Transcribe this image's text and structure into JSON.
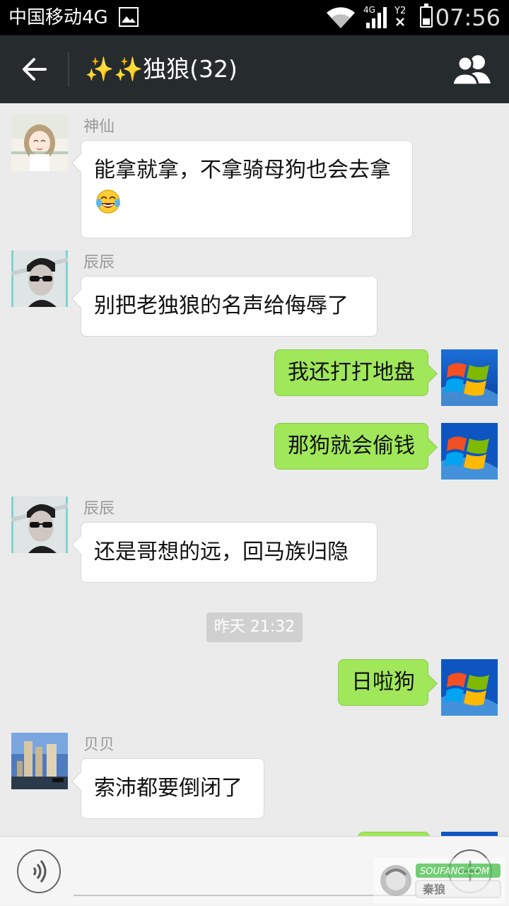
{
  "status_bar": {
    "carrier": "中国移动4G",
    "network": "4G",
    "sim_slot": "Y2",
    "time": "07:56",
    "battery_level": 0.4
  },
  "header": {
    "title": "✨✨独狼(32)"
  },
  "messages": [
    {
      "direction": "in",
      "sender": "神仙",
      "text": "能拿就拿，不拿骑母狗也会去拿",
      "emoji": "face-with-tears-of-joy",
      "avatar": "anime-girl-avatar"
    },
    {
      "direction": "in",
      "sender": "辰辰",
      "text": "别把老独狼的名声给侮辱了",
      "avatar": "sunglasses-man-avatar"
    },
    {
      "direction": "out",
      "text": "我还打打地盘",
      "avatar": "windows-logo-avatar"
    },
    {
      "direction": "out",
      "text": "那狗就会偷钱",
      "avatar": "windows-logo-avatar"
    },
    {
      "direction": "in",
      "sender": "辰辰",
      "text": "还是哥想的远，回马族归隐",
      "avatar": "sunglasses-man-avatar"
    },
    {
      "direction": "out",
      "text": "日啦狗",
      "avatar": "windows-logo-avatar"
    },
    {
      "direction": "in",
      "sender": "贝贝",
      "text": "索沛都要倒闭了",
      "avatar": "city-skyline-avatar"
    }
  ],
  "time_divider": "昨天 21:32",
  "input_bar": {
    "input_value": "",
    "watermark": "SOUFANG.COM 秦狼"
  },
  "colors": {
    "title_bar": "#262b2d",
    "chat_background": "#ebebeb",
    "outgoing_bubble": "#a0e75a",
    "incoming_bubble": "#ffffff"
  }
}
